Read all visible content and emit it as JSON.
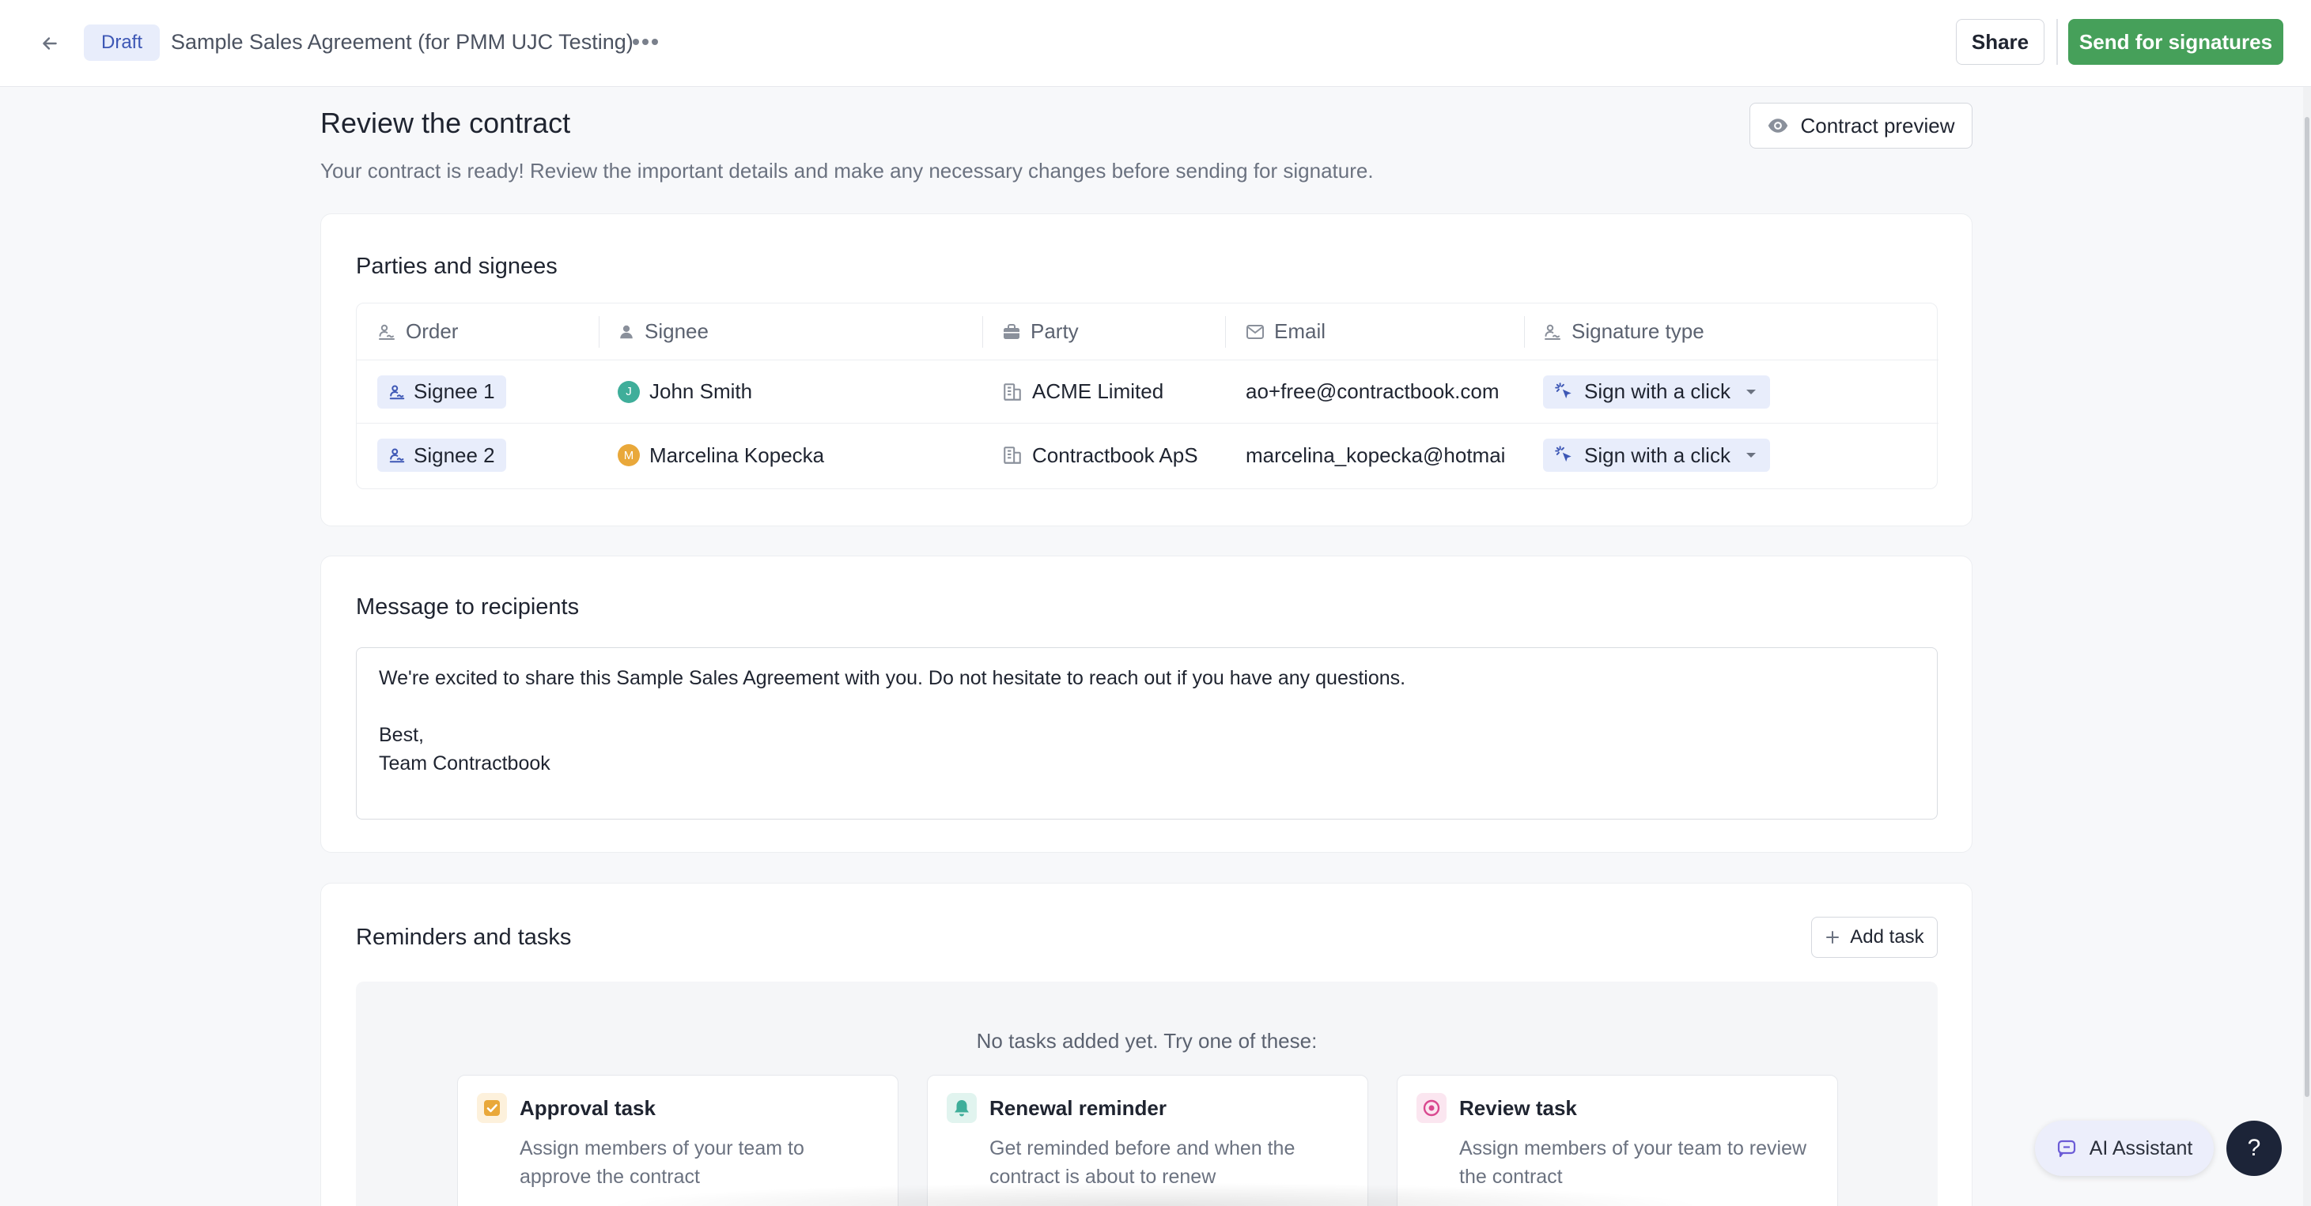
{
  "topbar": {
    "status_badge": "Draft",
    "document_title": "Sample Sales Agreement (for PMM UJC Testing)",
    "share_label": "Share",
    "send_label": "Send for signatures"
  },
  "header": {
    "title": "Review the contract",
    "subtitle": "Your contract is ready! Review the important details and make any necessary changes before sending for signature.",
    "preview_label": "Contract preview"
  },
  "parties": {
    "title": "Parties and signees",
    "columns": {
      "order": "Order",
      "signee": "Signee",
      "party": "Party",
      "email": "Email",
      "signature_type": "Signature type"
    },
    "rows": [
      {
        "order": "Signee 1",
        "initial": "J",
        "avatar_color": "#3fae9a",
        "name": "John Smith",
        "party": "ACME Limited",
        "email": "ao+free@contractbook.com",
        "signature_type": "Sign with a click"
      },
      {
        "order": "Signee 2",
        "initial": "M",
        "avatar_color": "#e9a83a",
        "name": "Marcelina Kopecka",
        "party": "Contractbook ApS",
        "email": "marcelina_kopecka@hotmai",
        "signature_type": "Sign with a click"
      }
    ]
  },
  "message": {
    "title": "Message to recipients",
    "lines": [
      "We're excited to share this Sample Sales Agreement with you. Do not hesitate to reach out if you have any questions.",
      "",
      "Best,",
      "Team Contractbook"
    ]
  },
  "reminders": {
    "title": "Reminders and tasks",
    "add_task_label": "Add task",
    "empty_text": "No tasks added yet. Try one of these:",
    "suggestions": [
      {
        "title": "Approval task",
        "description": "Assign members of your team to approve the contract",
        "icon": "checkbox-icon",
        "color": "#e9a83a"
      },
      {
        "title": "Renewal reminder",
        "description": "Get reminded before and when the contract is about to renew",
        "icon": "bell-icon",
        "color": "#3fae9a"
      },
      {
        "title": "Review task",
        "description": "Assign members of your team to review the contract",
        "icon": "eye-icon",
        "color": "#d9488f"
      }
    ]
  },
  "floating": {
    "ai_label": "AI Assistant",
    "help_label": "?"
  },
  "colors": {
    "accent": "#46a05a",
    "badge_bg": "#e8edfb",
    "badge_text": "#3d57b5"
  }
}
